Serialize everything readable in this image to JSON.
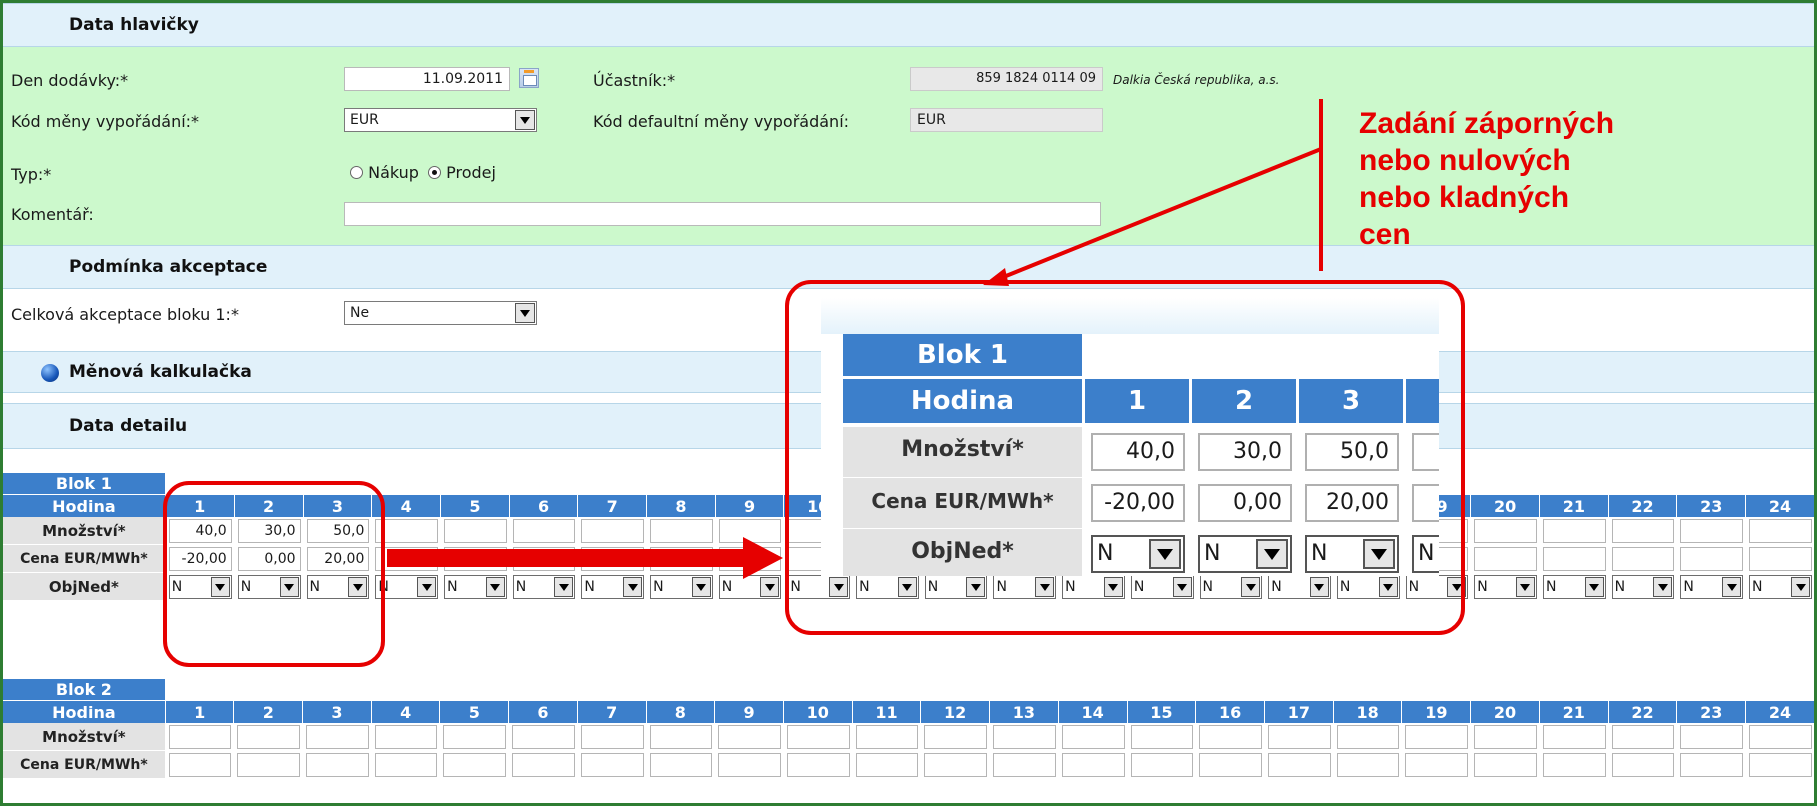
{
  "header_section": {
    "title": "Data hlavičky"
  },
  "fields": {
    "den_dodavky": {
      "label": "Den dodávky:*",
      "value": "11.09.2011"
    },
    "ucastnik": {
      "label": "Účastník:*",
      "value": "859 1824 0114 09",
      "name": "Dalkia Česká republika, a.s."
    },
    "kod_meny": {
      "label": "Kód měny vypořádání:*",
      "value": "EUR"
    },
    "kod_default_meny": {
      "label": "Kód defaultní měny vypořádání:",
      "value": "EUR"
    },
    "typ": {
      "label": "Typ:*",
      "option_nakup": "Nákup",
      "option_prodej": "Prodej",
      "selected": "Prodej"
    },
    "komentar": {
      "label": "Komentář:",
      "value": ""
    }
  },
  "acceptance_section": {
    "title": "Podmínka akceptace"
  },
  "acceptance": {
    "label": "Celková akceptace bloku 1:*",
    "value": "Ne"
  },
  "calculator": {
    "title": "Měnová kalkulačka",
    "icon": "globe-icon"
  },
  "detail_section": {
    "title": "Data detailu"
  },
  "row_labels": {
    "hour": "Hodina",
    "quantity": "Množství*",
    "price": "Cena EUR/MWh*",
    "order": "ObjNed*"
  },
  "hours": [
    "1",
    "2",
    "3",
    "4",
    "5",
    "6",
    "7",
    "8",
    "9",
    "10",
    "11",
    "12",
    "13",
    "14",
    "15",
    "16",
    "17",
    "18",
    "19",
    "20",
    "21",
    "22",
    "23",
    "24"
  ],
  "blocks": [
    {
      "name": "Blok 1",
      "quantities": [
        "40,0",
        "30,0",
        "50,0",
        "",
        "",
        "",
        "",
        "",
        "",
        "",
        "",
        "",
        "",
        "",
        "",
        "",
        "",
        "",
        "",
        "",
        "",
        "",
        "",
        ""
      ],
      "prices": [
        "-20,00",
        "0,00",
        "20,00",
        "",
        "",
        "",
        "",
        "",
        "",
        "",
        "",
        "",
        "",
        "",
        "",
        "",
        "",
        "",
        "",
        "",
        "",
        "",
        "",
        ""
      ],
      "order_default": "N"
    },
    {
      "name": "Blok 2",
      "quantities": [
        "",
        "",
        "",
        "",
        "",
        "",
        "",
        "",
        "",
        "",
        "",
        "",
        "",
        "",
        "",
        "",
        "",
        "",
        "",
        "",
        "",
        "",
        "",
        ""
      ],
      "prices": [
        "",
        "",
        "",
        "",
        "",
        "",
        "",
        "",
        "",
        "",
        "",
        "",
        "",
        "",
        "",
        "",
        "",
        "",
        "",
        "",
        "",
        "",
        "",
        ""
      ]
    }
  ],
  "zoom": {
    "block": "Blok 1",
    "hours": [
      "1",
      "2",
      "3"
    ],
    "quantities": [
      "40,0",
      "30,0",
      "50,0"
    ],
    "prices": [
      "-20,00",
      "0,00",
      "20,00"
    ],
    "orders": [
      "N",
      "N",
      "N",
      "N"
    ]
  },
  "annotation": {
    "lines": [
      "Zadání záporných",
      "nebo nulových",
      "nebo kladných",
      "cen"
    ],
    "color": "#e60000"
  },
  "colors": {
    "header_blue": "#3c7fcb",
    "green_panel": "#ccf9cc",
    "section_bar": "#e1f1fa",
    "frame": "#2e7d32"
  }
}
